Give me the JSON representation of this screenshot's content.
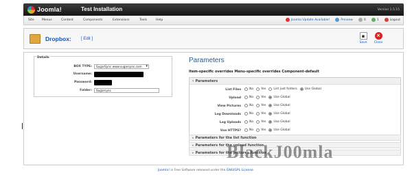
{
  "header": {
    "logo_text": "Joomla!",
    "site_title": "Test Installation",
    "version": "Version 1.5.15"
  },
  "menu": {
    "items": [
      "Site",
      "Menus",
      "Content",
      "Components",
      "Extensions",
      "Tools",
      "Help"
    ]
  },
  "status": {
    "update": "Joomla Update Available!",
    "preview": "Preview",
    "messages": "0",
    "users": "1",
    "logout": "Logout"
  },
  "toolbar": {
    "title": "Dropbox:",
    "edit": "[ Edit ]",
    "save": "Save",
    "close": "Close"
  },
  "details": {
    "legend": "Details",
    "box_type_label": "BOX TYPE:",
    "box_type_value": "SugarSync www.sugarsync.com",
    "username_label": "Username:",
    "password_label": "Password:",
    "folder_label": "Folder:",
    "folder_value": "Sugarsync"
  },
  "params": {
    "title": "Parameters",
    "subtitle": "Item-specific overrides Menu-specific overrides Component-default",
    "section_label": "Parameters",
    "rows": [
      {
        "label": "List Files",
        "options": [
          "No",
          "Yes",
          "List just folders",
          "Use Global"
        ],
        "selected": 3
      },
      {
        "label": "Upload",
        "options": [
          "No",
          "Yes",
          "Use Global"
        ],
        "selected": 2
      },
      {
        "label": "View Pictures",
        "options": [
          "No",
          "Yes",
          "Use Global"
        ],
        "selected": 2
      },
      {
        "label": "Log Downloads",
        "options": [
          "No",
          "Yes",
          "Use Global"
        ],
        "selected": 2
      },
      {
        "label": "Log Uploads",
        "options": [
          "No",
          "Yes",
          "Use Global"
        ],
        "selected": 2
      },
      {
        "label": "Use HTTPS?",
        "options": [
          "No",
          "Yes",
          "Use Global"
        ],
        "selected": 2
      }
    ],
    "sections": [
      "Parameters for the list function",
      "Parameters for the upload function",
      "Parameters for the pictures function"
    ]
  },
  "footer": {
    "link1": "Joomla!",
    "text": " is Free Software released under the ",
    "link2": "GNU/GPL License."
  },
  "watermark": "BlackJ00mla"
}
